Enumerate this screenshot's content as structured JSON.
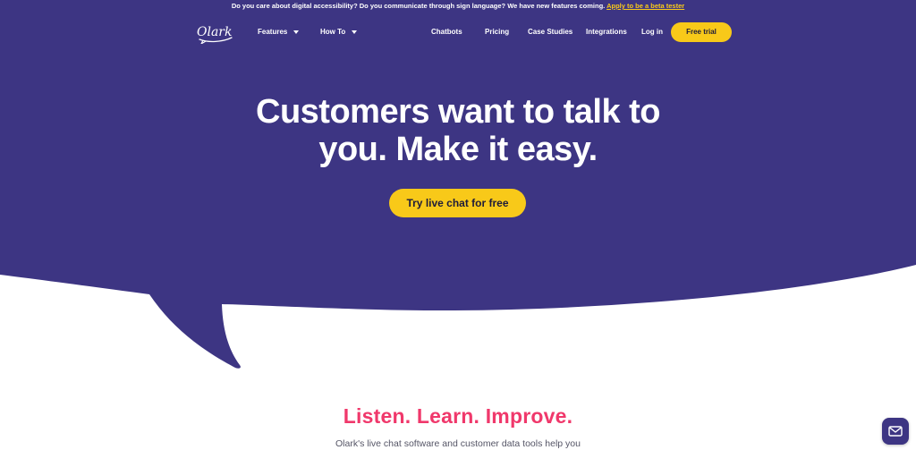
{
  "colors": {
    "hero_bg": "#3d3583",
    "accent_yellow": "#f8c919",
    "heading_pink": "#f0386b",
    "white": "#ffffff"
  },
  "announcement": {
    "text": "Do you care about digital accessibility? Do you communicate through sign language? We have new features coming.",
    "link": "Apply to be a beta tester"
  },
  "header": {
    "logo_text": "Olark",
    "nav_left": [
      {
        "label": "Features",
        "icon": "chevron-down-icon"
      },
      {
        "label": "How To",
        "icon": "chevron-down-icon"
      }
    ],
    "nav_right": [
      "Chatbots",
      "Pricing",
      "Case Studies",
      "Integrations",
      "Log in"
    ],
    "cta": "Free trial"
  },
  "hero": {
    "headline_line1": "Customers want to talk to",
    "headline_line2": "you. Make it easy.",
    "cta": "Try live chat for free"
  },
  "section": {
    "title": "Listen. Learn. Improve.",
    "text": "Olark's live chat software and customer data tools help you"
  },
  "chat_widget": {
    "icon": "mail-icon"
  }
}
